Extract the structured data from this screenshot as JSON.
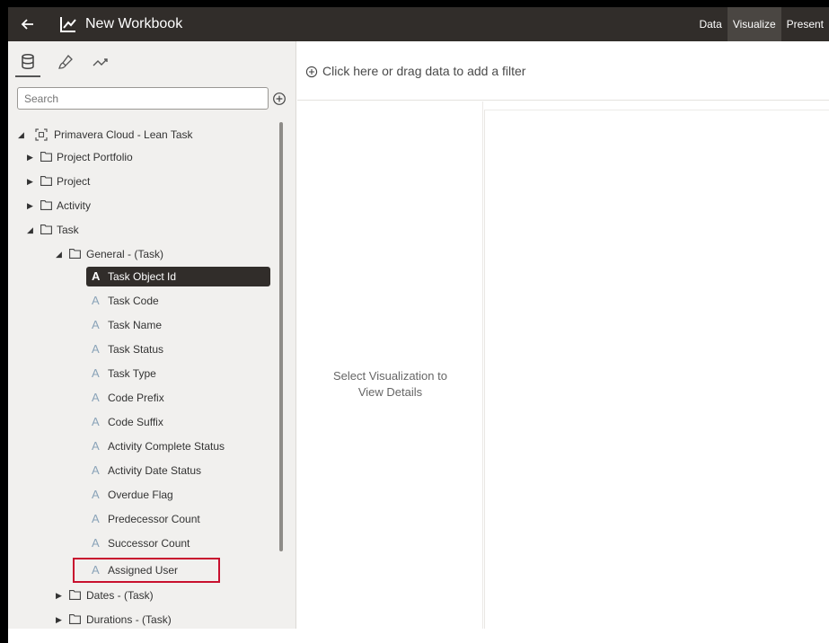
{
  "header": {
    "title": "New Workbook",
    "tabs": [
      {
        "label": "Data",
        "active": false
      },
      {
        "label": "Visualize",
        "active": true
      },
      {
        "label": "Present",
        "active": false
      }
    ]
  },
  "panel": {
    "tabs": [
      {
        "icon": "database-icon",
        "active": true
      },
      {
        "icon": "brush-icon",
        "active": false
      },
      {
        "icon": "analytics-icon",
        "active": false
      }
    ],
    "search": {
      "placeholder": "Search",
      "value": ""
    },
    "tree": [
      {
        "label": "Primavera Cloud - Lean Task",
        "type": "subject-area",
        "expanded": true
      },
      {
        "label": "Project Portfolio",
        "type": "folder",
        "expanded": false
      },
      {
        "label": "Project",
        "type": "folder",
        "expanded": false
      },
      {
        "label": "Activity",
        "type": "folder",
        "expanded": false
      },
      {
        "label": "Task",
        "type": "folder",
        "expanded": true
      },
      {
        "label": "General - (Task)",
        "type": "folder",
        "expanded": true
      },
      {
        "label": "Task Object Id",
        "type": "attribute",
        "selected": true
      },
      {
        "label": "Task Code",
        "type": "attribute"
      },
      {
        "label": "Task Name",
        "type": "attribute"
      },
      {
        "label": "Task Status",
        "type": "attribute"
      },
      {
        "label": "Task Type",
        "type": "attribute"
      },
      {
        "label": "Code Prefix",
        "type": "attribute"
      },
      {
        "label": "Code Suffix",
        "type": "attribute"
      },
      {
        "label": "Activity Complete Status",
        "type": "attribute"
      },
      {
        "label": "Activity Date Status",
        "type": "attribute"
      },
      {
        "label": "Overdue Flag",
        "type": "attribute"
      },
      {
        "label": "Predecessor Count",
        "type": "attribute"
      },
      {
        "label": "Successor Count",
        "type": "attribute"
      },
      {
        "label": "Assigned User",
        "type": "attribute",
        "highlighted": true
      },
      {
        "label": "Dates - (Task)",
        "type": "folder",
        "expanded": false
      },
      {
        "label": "Durations - (Task)",
        "type": "folder",
        "expanded": false
      }
    ]
  },
  "filter_bar": {
    "text": "Click here or drag data to add a filter"
  },
  "grammar": {
    "message_line1": "Select Visualization to",
    "message_line2": "View Details"
  },
  "colors": {
    "header": "#312d2a",
    "selected": "#312d2a",
    "panel": "#f1f0ee",
    "highlight": "#c8102e",
    "attribute_icon": "#8aa3b8"
  },
  "attribute_glyph": "A"
}
